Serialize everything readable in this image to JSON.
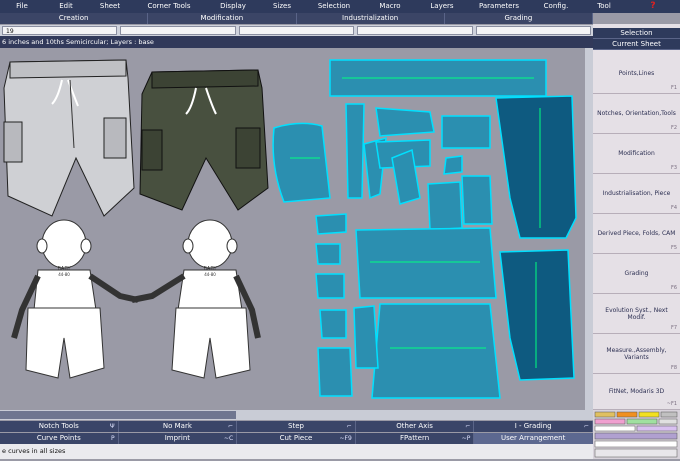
{
  "menu": [
    "File",
    "Edit",
    "Sheet",
    "Corner Tools",
    "Display",
    "Sizes",
    "Selection",
    "Macro",
    "Layers",
    "Parameters",
    "Config.",
    "Tool"
  ],
  "help_glyph": "?",
  "tabs": [
    "Creation",
    "Modification",
    "Industrialization",
    "Grading"
  ],
  "value_field": "19",
  "info_text": "6 inches and 10ths Semicircular;   Layers :  base",
  "shirt_print": "BABY\n44-80",
  "right_panel": {
    "header1": "Selection",
    "header2": "Current Sheet",
    "buttons": [
      {
        "label": "Points,Lines",
        "key": "F1"
      },
      {
        "label": "Notches, Orientation,Tools",
        "key": "F2"
      },
      {
        "label": "Modification",
        "key": "F3"
      },
      {
        "label": "Industrialisation, Piece",
        "key": "F4"
      },
      {
        "label": "Derived Piece, Folds, CAM",
        "key": "F5"
      },
      {
        "label": "Grading",
        "key": "F6"
      },
      {
        "label": "Evolution Syst., Next Modif.",
        "key": "F7"
      },
      {
        "label": "Measure.,Assembly, Variants",
        "key": "F8"
      },
      {
        "label": "FitNet, Modaris 3D",
        "key": "~F1"
      }
    ]
  },
  "bottom_rows": [
    [
      {
        "label": "Notch Tools",
        "key": "Ψ"
      },
      {
        "label": "No Mark",
        "key": "⌐"
      },
      {
        "label": "Step",
        "key": "⌐"
      },
      {
        "label": "Other Axis",
        "key": "⌐"
      },
      {
        "label": "I - Grading",
        "key": "⌐"
      }
    ],
    [
      {
        "label": "Curve Points",
        "key": "P"
      },
      {
        "label": "Imprint",
        "key": "~C"
      },
      {
        "label": "Cut Piece",
        "key": "~F9"
      },
      {
        "label": "FPattern",
        "key": "~P"
      },
      {
        "label": "User Arrangement",
        "key": ""
      }
    ]
  ],
  "status_text": "e curves in all sizes",
  "colors": {
    "pattern_fill": "#2b8fb0",
    "pattern_dark": "#0e5a80",
    "pattern_edge": "#00e0ff",
    "grain": "#00ff80",
    "accent_help": "#e02020"
  }
}
